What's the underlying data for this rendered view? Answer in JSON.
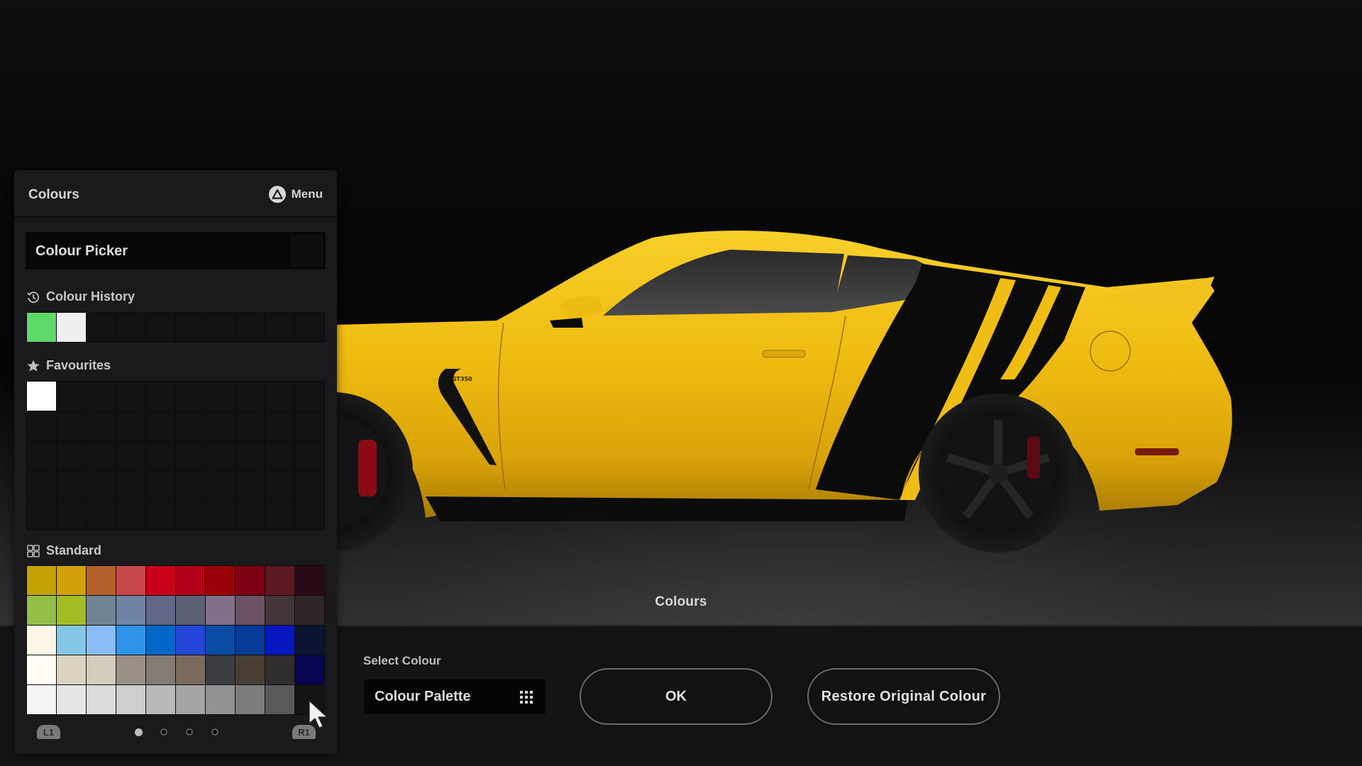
{
  "scene": {
    "title": "Colours",
    "car": {
      "body_color": "#f2be12",
      "stripe_color": "#0b0b0c",
      "badge": "GT350",
      "caliper_color": "#8a0b14"
    }
  },
  "panel": {
    "title": "Colours",
    "menu_label": "Menu",
    "menu_icon": "triangle-button-icon",
    "colour_picker_label": "Colour Picker",
    "history": {
      "label": "Colour History",
      "icon": "history-clock-icon",
      "swatches": [
        "#5ed96a",
        "#efefef",
        "",
        "",
        "",
        "",
        "",
        "",
        "",
        ""
      ]
    },
    "favourites": {
      "label": "Favourites",
      "icon": "star-icon",
      "swatches": [
        "#ffffff",
        "",
        "",
        "",
        "",
        "",
        "",
        "",
        "",
        "",
        "",
        "",
        "",
        "",
        "",
        "",
        "",
        "",
        "",
        "",
        "",
        "",
        "",
        "",
        "",
        "",
        "",
        "",
        "",
        "",
        "",
        "",
        "",
        "",
        "",
        "",
        "",
        "",
        "",
        "",
        "",
        "",
        "",
        "",
        "",
        "",
        "",
        "",
        "",
        ""
      ]
    },
    "standard": {
      "label": "Standard",
      "icon": "grid-icon",
      "swatches": [
        "#c2a200",
        "#d2a10a",
        "#b35f2a",
        "#c9464b",
        "#c8001a",
        "#b3001a",
        "#9a0008",
        "#7d0012",
        "#5e1820",
        "#2b0a18",
        "#94c048",
        "#a4bc25",
        "#6f8394",
        "#6e84a0",
        "#626786",
        "#5c6073",
        "#82708a",
        "#6a5262",
        "#43353a",
        "#2f2627",
        "#fdf6e6",
        "#84c7e6",
        "#8abdf5",
        "#2f93ea",
        "#0068c9",
        "#2146d8",
        "#0b4ca5",
        "#063b98",
        "#0617c2",
        "#0b1430",
        "#fffdf6",
        "#dcd2c0",
        "#d4cdbc",
        "#9a9088",
        "#857b76",
        "#7b6a5e",
        "#3b3d42",
        "#4a3f35",
        "#2f2d2d",
        "#0a0550",
        "#f4f4f6",
        "#e6e6e8",
        "#dcdcde",
        "#cecece",
        "#b9b8ba",
        "#a5a4a6",
        "#939294",
        "#7c7b7d",
        "#59585a",
        "#141316"
      ]
    },
    "pager": {
      "left_button": "L1",
      "right_button": "R1",
      "pages": 4,
      "current_page": 1
    }
  },
  "bottom_bar": {
    "select_colour_label": "Select Colour",
    "dropdown_value": "Colour Palette",
    "ok_label": "OK",
    "restore_label": "Restore Original Colour"
  }
}
